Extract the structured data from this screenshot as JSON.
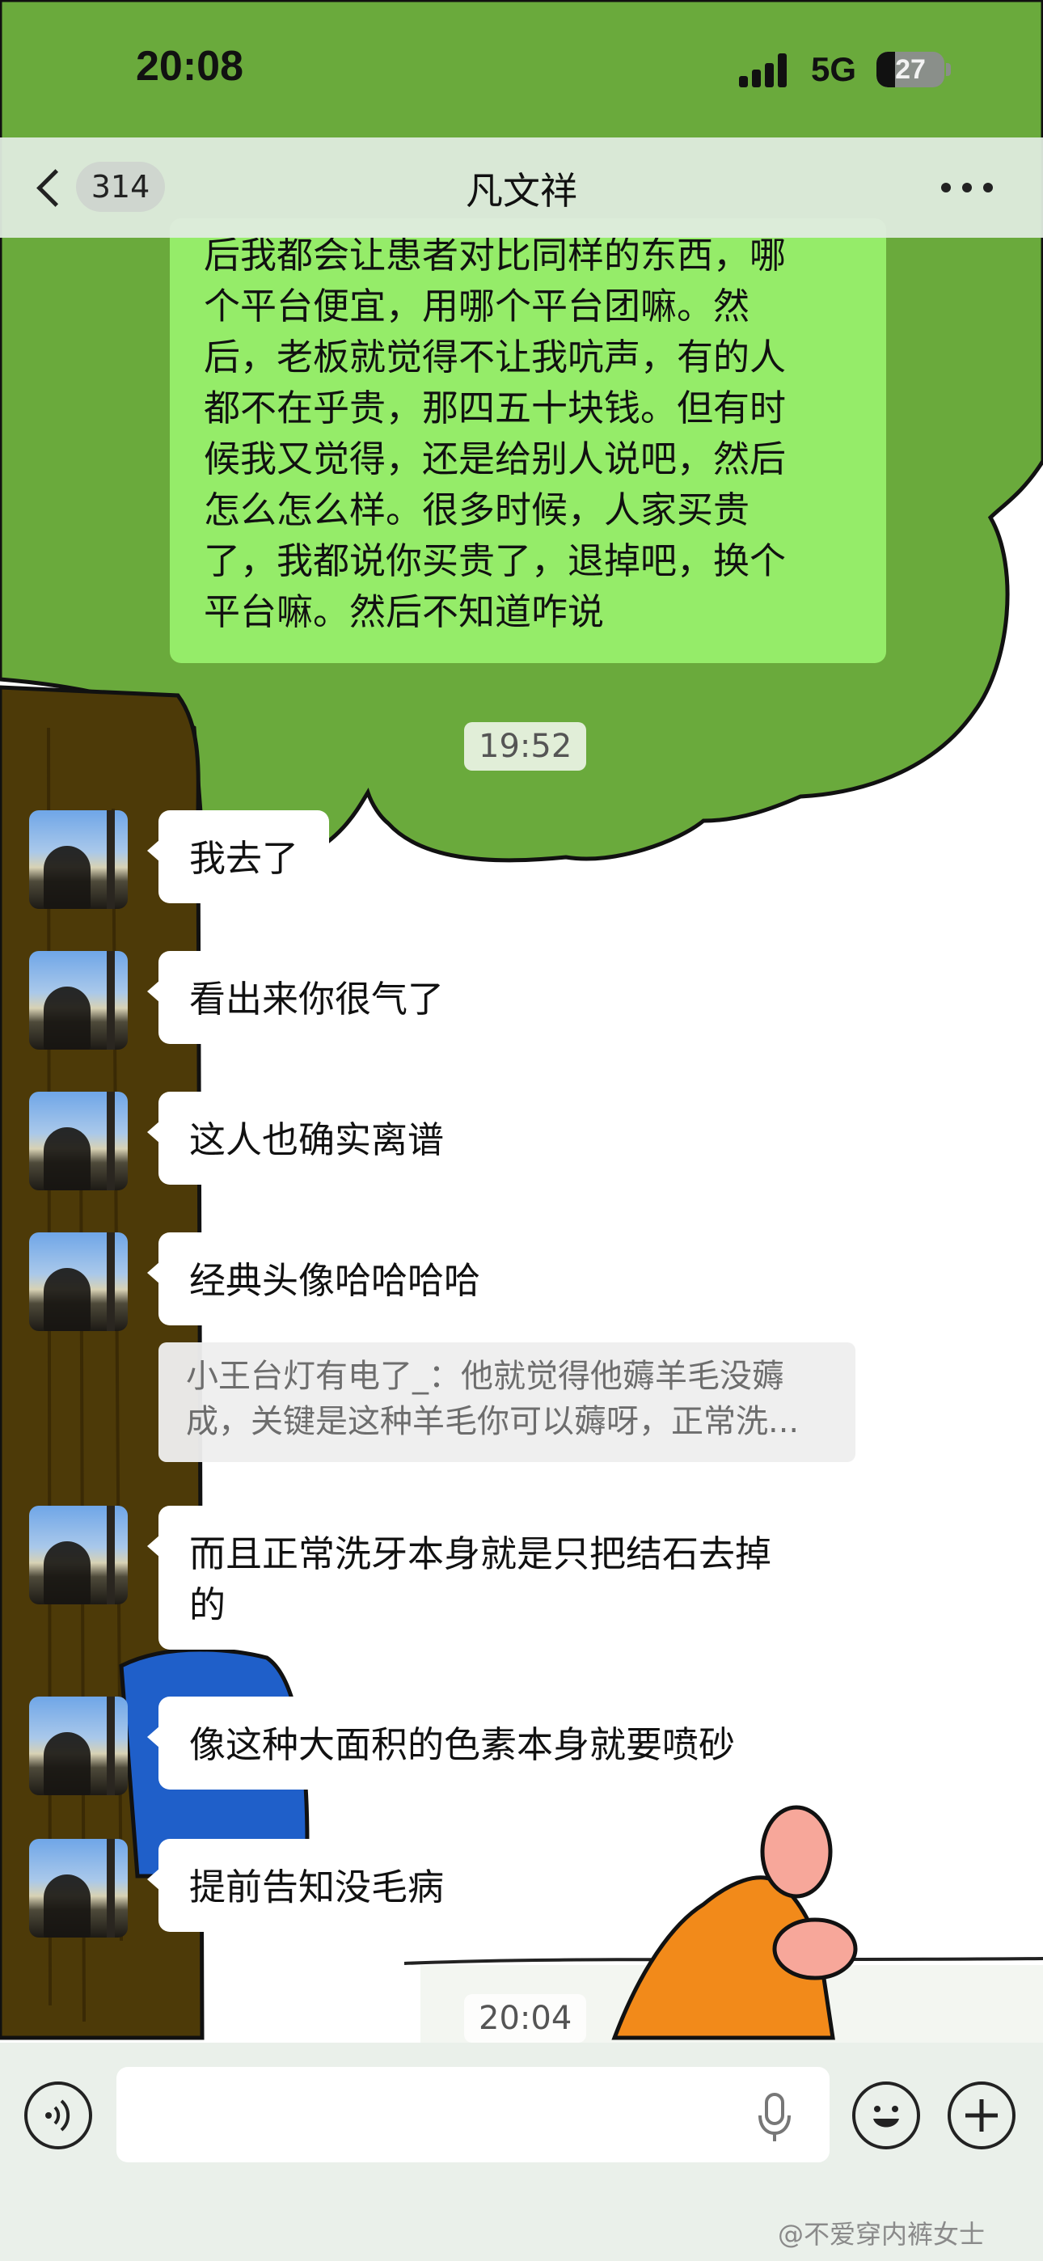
{
  "status_bar": {
    "time": "20:08",
    "network": "5G",
    "battery": "27",
    "battery_level_percent": 27
  },
  "header": {
    "back_badge": "314",
    "title": "凡文祥",
    "more_icon": "more-dots-icon"
  },
  "messages": {
    "outgoing": {
      "lines": [
        "后我都会让患者对比同样的东西，哪",
        "个平台便宜，用哪个平台团嘛。然",
        "后，老板就觉得不让我吭声，有的人",
        "都不在乎贵，那四五十块钱。但有时",
        "候我又觉得，还是给别人说吧，然后",
        "怎么怎么样。很多时候，人家买贵",
        "了，我都说你买贵了，退掉吧，换个",
        "平台嘛。然后不知道咋说"
      ]
    },
    "time_1": "19:52",
    "incoming": [
      {
        "text": "我去了"
      },
      {
        "text": "看出来你很气了"
      },
      {
        "text": "这人也确实离谱"
      },
      {
        "text": "经典头像哈哈哈哈"
      },
      {
        "line1": "而且正常洗牙本身就是只把结石去掉",
        "line2": "的"
      },
      {
        "text": "像这种大面积的色素本身就要喷砂"
      },
      {
        "text": "提前告知没毛病"
      }
    ],
    "quote": {
      "line1": "小王台灯有电了_：他就觉得他薅羊毛没薅",
      "line2": "成，关键是这种羊毛你可以薅呀，正常洗..."
    },
    "time_2": "20:04"
  },
  "input_bar": {
    "placeholder": "",
    "voice_icon": "voice-icon",
    "mic_icon": "microphone-icon",
    "emoji_icon": "emoji-icon",
    "add_icon": "plus-icon"
  },
  "watermark": "@不爱穿内裤女士",
  "colors": {
    "outgoing_bubble": "#95ec69",
    "wallpaper_green": "#6aaa3c",
    "trunk_brown": "#4d3a08",
    "header_bg": "#e0ece0"
  }
}
